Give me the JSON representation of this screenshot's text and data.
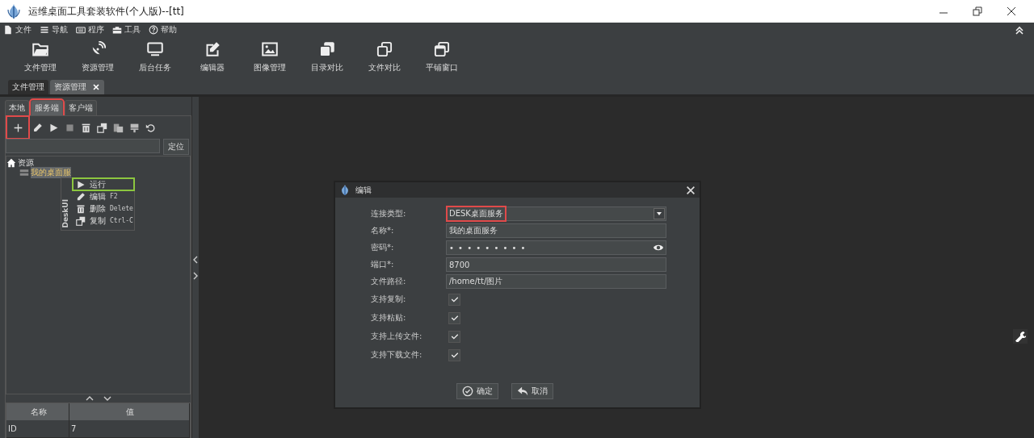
{
  "window": {
    "title": "运维桌面工具套装软件(个人版)--[tt]"
  },
  "menu": [
    {
      "label": "文件"
    },
    {
      "label": "导航"
    },
    {
      "label": "程序"
    },
    {
      "label": "工具"
    },
    {
      "label": "帮助"
    }
  ],
  "toolbar": [
    {
      "label": "文件管理"
    },
    {
      "label": "资源管理"
    },
    {
      "label": "后台任务"
    },
    {
      "label": "编辑器"
    },
    {
      "label": "图像管理"
    },
    {
      "label": "目录对比"
    },
    {
      "label": "文件对比"
    },
    {
      "label": "平铺窗口"
    }
  ],
  "doc_tabs": [
    {
      "label": "文件管理",
      "selected": false
    },
    {
      "label": "资源管理",
      "selected": true
    }
  ],
  "side_tabs": [
    {
      "label": "本地",
      "selected": false,
      "highlighted": false
    },
    {
      "label": "服务端",
      "selected": true,
      "highlighted": true
    },
    {
      "label": "客户端",
      "selected": false,
      "highlighted": false
    }
  ],
  "side_toolbar": [
    {
      "highlighted": true
    },
    {
      "highlighted": false
    },
    {
      "highlighted": false
    },
    {
      "highlighted": false
    },
    {
      "highlighted": false
    },
    {
      "highlighted": false
    },
    {
      "highlighted": false
    },
    {
      "highlighted": false
    },
    {
      "highlighted": false
    }
  ],
  "search": {
    "button": "定位"
  },
  "tree": [
    {
      "label": "资源",
      "children": [
        {
          "label": "我的桌面服",
          "selected": true
        }
      ]
    }
  ],
  "context_menu": {
    "side_label": "DeskUI",
    "items": [
      {
        "label": "运行",
        "highlighted": true
      },
      {
        "label": "编辑",
        "shortcut": "F2",
        "highlighted": false
      },
      {
        "label": "删除",
        "shortcut": "Delete",
        "highlighted": false
      },
      {
        "label": "复制",
        "shortcut": "Ctrl-C",
        "highlighted": false
      }
    ]
  },
  "properties": {
    "columns": [
      "名称",
      "值"
    ],
    "rows": [
      [
        "ID",
        "7"
      ]
    ]
  },
  "dialog": {
    "title": "编辑",
    "fields": [
      {
        "kind": "select",
        "label": "连接类型:",
        "value": "DESK桌面服务",
        "highlighted": true
      },
      {
        "kind": "text",
        "label": "名称*:",
        "value": "我的桌面服务"
      },
      {
        "kind": "password",
        "label": "密码*:",
        "value": "• • • • • • • • •"
      },
      {
        "kind": "text",
        "label": "端口*:",
        "value": "8700"
      },
      {
        "kind": "text",
        "label": "文件路径:",
        "value": "/home/tt/图片"
      },
      {
        "kind": "checkbox",
        "label": "支持复制:",
        "checked": true
      },
      {
        "kind": "checkbox",
        "label": "支持粘贴:",
        "checked": true
      },
      {
        "kind": "checkbox",
        "label": "支持上传文件:",
        "checked": true
      },
      {
        "kind": "checkbox",
        "label": "支持下载文件:",
        "checked": true
      }
    ],
    "buttons": [
      {
        "label": "确定"
      },
      {
        "label": "取消"
      }
    ]
  }
}
